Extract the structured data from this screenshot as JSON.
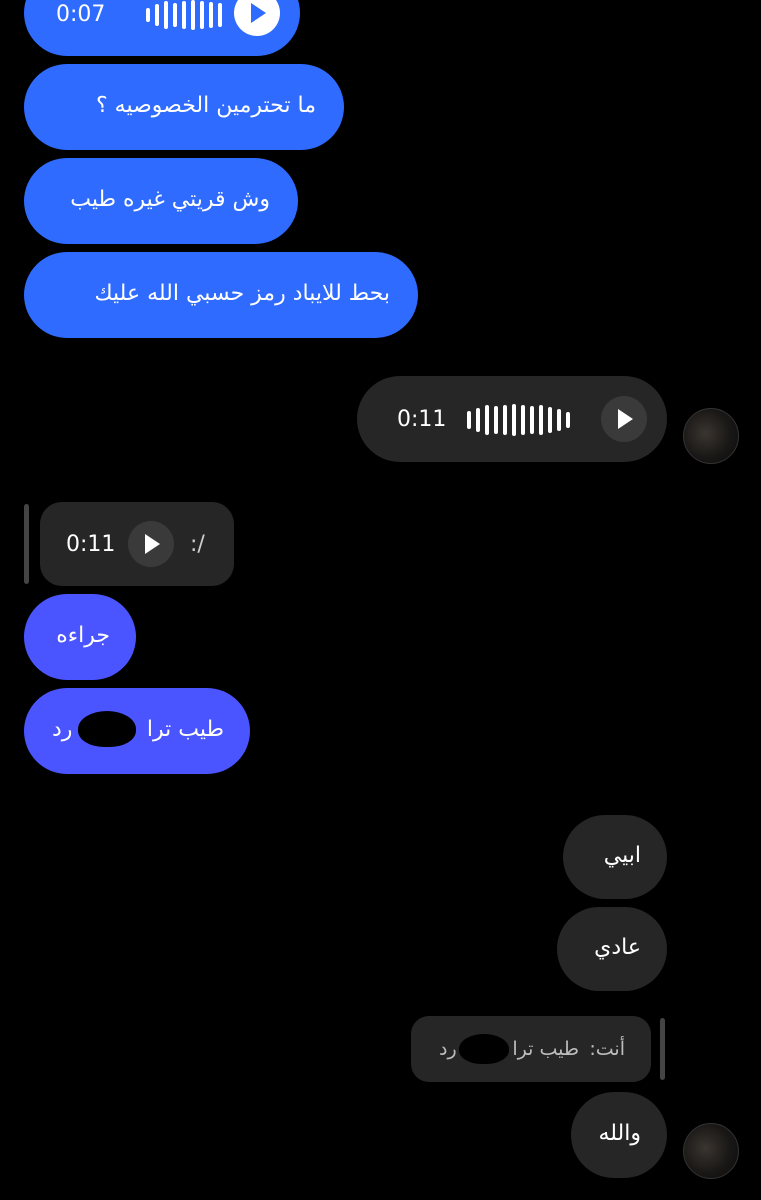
{
  "messages": {
    "voice1": {
      "duration": "0:07"
    },
    "m1": {
      "text": "ما تحترمين الخصوصيه ؟"
    },
    "m2": {
      "text": "وش قريتي غيره طيب"
    },
    "m3": {
      "text": "بحط للايباد رمز حسبي الله عليك"
    },
    "voice2": {
      "duration": "0:11"
    },
    "reply_voice": {
      "duration": "0:11",
      "caption": ":/"
    },
    "m4": {
      "text": "جراءه"
    },
    "m5": {
      "text_right": "طيب ترا",
      "text_left": "رد"
    },
    "m6": {
      "text": "ابيي"
    },
    "m7": {
      "text": "عادي"
    },
    "reply_quote": {
      "prefix": "أنت:",
      "text": "طيب ترا",
      "text_end": "رد"
    },
    "m8": {
      "text": "والله"
    }
  },
  "icons": {
    "play": "play-icon",
    "waveform": "waveform-icon",
    "avatar": "avatar-photo"
  },
  "colors": {
    "background": "#000000",
    "outgoing_blue": "#2f6bff",
    "outgoing_violet": "#4a55ff",
    "incoming_gray": "#262626"
  }
}
